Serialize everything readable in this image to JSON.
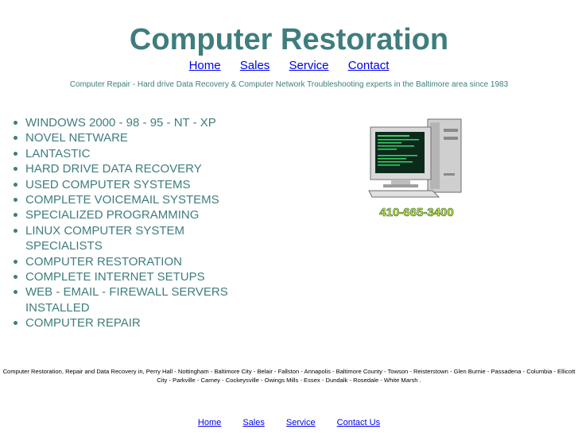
{
  "header": {
    "title": "Computer Restoration",
    "tagline": "Computer Repair - Hard drive Data Recovery & Computer Network Troubleshooting experts in the Baltimore area since 1983"
  },
  "top_nav": [
    {
      "label": "Home"
    },
    {
      "label": "Sales"
    },
    {
      "label": "Service"
    },
    {
      "label": "Contact"
    }
  ],
  "services": [
    "WINDOWS 2000 - 98 - 95 - NT - XP",
    "NOVEL NETWARE",
    "LANTASTIC",
    "HARD DRIVE DATA RECOVERY",
    "USED COMPUTER SYSTEMS",
    "COMPLETE VOICEMAIL SYSTEMS",
    "SPECIALIZED PROGRAMMING",
    "LINUX COMPUTER SYSTEM SPECIALISTS",
    "COMPUTER RESTORATION",
    "COMPLETE INTERNET SETUPS",
    "WEB - EMAIL - FIREWALL SERVERS INSTALLED",
    "COMPUTER REPAIR"
  ],
  "image": {
    "icon": "desktop-computer-icon",
    "phone": "410-665-3400"
  },
  "footer": {
    "text": "Computer Restoration, Repair and Data Recovery in, Perry Hall - Nottingham - Baltimore City - Belair - Fallston - Annapolis - Baltimore County - Towson - Reisterstown - Glen Burnie - Passadena - Columbia - Ellicott City - Parkville - Carney - Cockeysville - Owings Mills - Essex - Dundalk - Rosedale - White Marsh ."
  },
  "bottom_nav": [
    {
      "label": "Home"
    },
    {
      "label": "Sales"
    },
    {
      "label": "Service"
    },
    {
      "label": "Contact Us"
    }
  ],
  "colors": {
    "accent": "#3f7d7d",
    "link": "#0000ee",
    "phone_text": "#c8e84a"
  }
}
